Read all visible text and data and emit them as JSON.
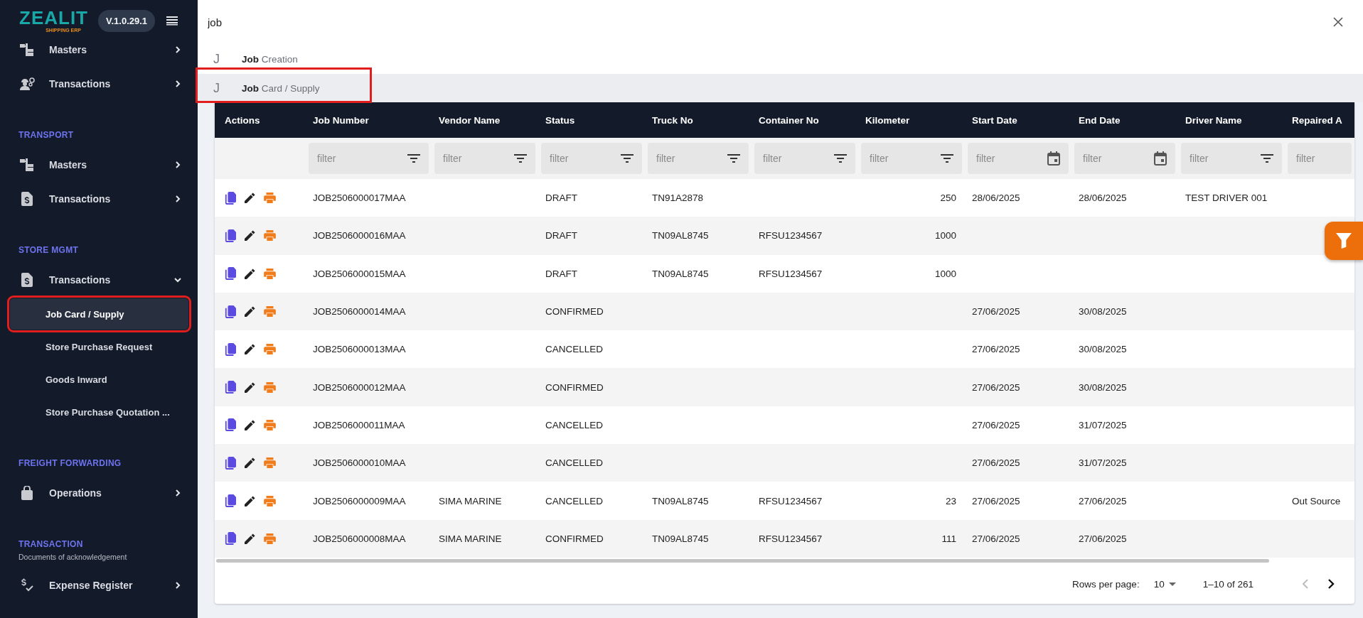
{
  "sidebar": {
    "logo": {
      "name": "ZEALIT",
      "tagline": "SHIPPING ERP"
    },
    "version": "V.1.0.29.1",
    "sections": [
      {
        "items": [
          {
            "label": "Masters",
            "kind": "hierarchy",
            "expanded": false
          },
          {
            "label": "Transactions",
            "kind": "worker",
            "expanded": false
          }
        ]
      },
      {
        "title": "TRANSPORT",
        "items": [
          {
            "label": "Masters",
            "kind": "hierarchy",
            "expanded": false
          },
          {
            "label": "Transactions",
            "kind": "invoice",
            "expanded": false
          }
        ]
      },
      {
        "title": "STORE MGMT",
        "items": [
          {
            "label": "Transactions",
            "kind": "invoice",
            "expanded": true,
            "children": [
              {
                "label": "Job Card / Supply",
                "selected": true,
                "highlighted": true
              },
              {
                "label": "Store Purchase Request",
                "selected": false,
                "highlighted": false
              },
              {
                "label": "Goods Inward",
                "selected": false,
                "highlighted": false
              },
              {
                "label": "Store Purchase Quotation ...",
                "selected": false,
                "highlighted": false
              }
            ]
          }
        ]
      },
      {
        "title": "FREIGHT FORWARDING",
        "items": [
          {
            "label": "Operations",
            "kind": "bag",
            "expanded": false
          }
        ]
      },
      {
        "title": "TRANSACTION",
        "subtitle": "Documents of acknowledgement",
        "items": [
          {
            "label": "Expense Register",
            "kind": "expense",
            "expanded": false
          }
        ]
      }
    ]
  },
  "search": {
    "value": "job"
  },
  "suggestions": [
    {
      "letter": "J",
      "text": "**Job** Creation",
      "selected": false,
      "highlighted": false
    },
    {
      "letter": "J",
      "text": "**Job** Card / Supply",
      "selected": true,
      "highlighted": true
    }
  ],
  "table": {
    "columns": [
      {
        "label": "Actions",
        "kind": "actions"
      },
      {
        "label": "Job Number",
        "kind": "text",
        "filter_placeholder": "filter"
      },
      {
        "label": "Vendor Name",
        "kind": "text",
        "filter_placeholder": "filter"
      },
      {
        "label": "Status",
        "kind": "text",
        "filter_placeholder": "filter"
      },
      {
        "label": "Truck No",
        "kind": "text",
        "filter_placeholder": "filter"
      },
      {
        "label": "Container No",
        "kind": "text",
        "filter_placeholder": "filter"
      },
      {
        "label": "Kilometer",
        "kind": "number",
        "filter_placeholder": "filter"
      },
      {
        "label": "Start Date",
        "kind": "date",
        "filter_placeholder": "filter"
      },
      {
        "label": "End Date",
        "kind": "date",
        "filter_placeholder": "filter"
      },
      {
        "label": "Driver Name",
        "kind": "text",
        "filter_placeholder": "filter"
      },
      {
        "label": "Repaired A",
        "kind": "plain",
        "filter_placeholder": "filter"
      }
    ],
    "rows": [
      {
        "job_number": "JOB2506000017MAA",
        "status": "DRAFT",
        "truck": "TN91A2878",
        "km": "250",
        "start": "28/06/2025",
        "end": "28/06/2025",
        "driver": "TEST DRIVER 001"
      },
      {
        "job_number": "JOB2506000016MAA",
        "status": "DRAFT",
        "truck": "TN09AL8745",
        "container": "RFSU1234567",
        "km": "1000"
      },
      {
        "job_number": "JOB2506000015MAA",
        "status": "DRAFT",
        "truck": "TN09AL8745",
        "container": "RFSU1234567",
        "km": "1000"
      },
      {
        "job_number": "JOB2506000014MAA",
        "status": "CONFIRMED",
        "start": "27/06/2025",
        "end": "30/08/2025"
      },
      {
        "job_number": "JOB2506000013MAA",
        "status": "CANCELLED",
        "start": "27/06/2025",
        "end": "30/08/2025"
      },
      {
        "job_number": "JOB2506000012MAA",
        "status": "CONFIRMED",
        "start": "27/06/2025",
        "end": "30/08/2025"
      },
      {
        "job_number": "JOB2506000011MAA",
        "status": "CANCELLED",
        "start": "27/06/2025",
        "end": "31/07/2025"
      },
      {
        "job_number": "JOB2506000010MAA",
        "status": "CANCELLED",
        "start": "27/06/2025",
        "end": "31/07/2025"
      },
      {
        "job_number": "JOB2506000009MAA",
        "vendor": "SIMA MARINE",
        "status": "CANCELLED",
        "truck": "TN09AL8745",
        "container": "RFSU1234567",
        "km": "23",
        "start": "27/06/2025",
        "end": "27/06/2025",
        "repaired": "Out Source"
      },
      {
        "job_number": "JOB2506000008MAA",
        "vendor": "SIMA MARINE",
        "status": "CONFIRMED",
        "truck": "TN09AL8745",
        "container": "RFSU1234567",
        "km": "111",
        "start": "27/06/2025",
        "end": "27/06/2025"
      }
    ]
  },
  "pagination": {
    "rows_label": "Rows per page:",
    "rows_value": "10",
    "range": "1–10 of 261",
    "prev_disabled": true,
    "next_disabled": false
  }
}
